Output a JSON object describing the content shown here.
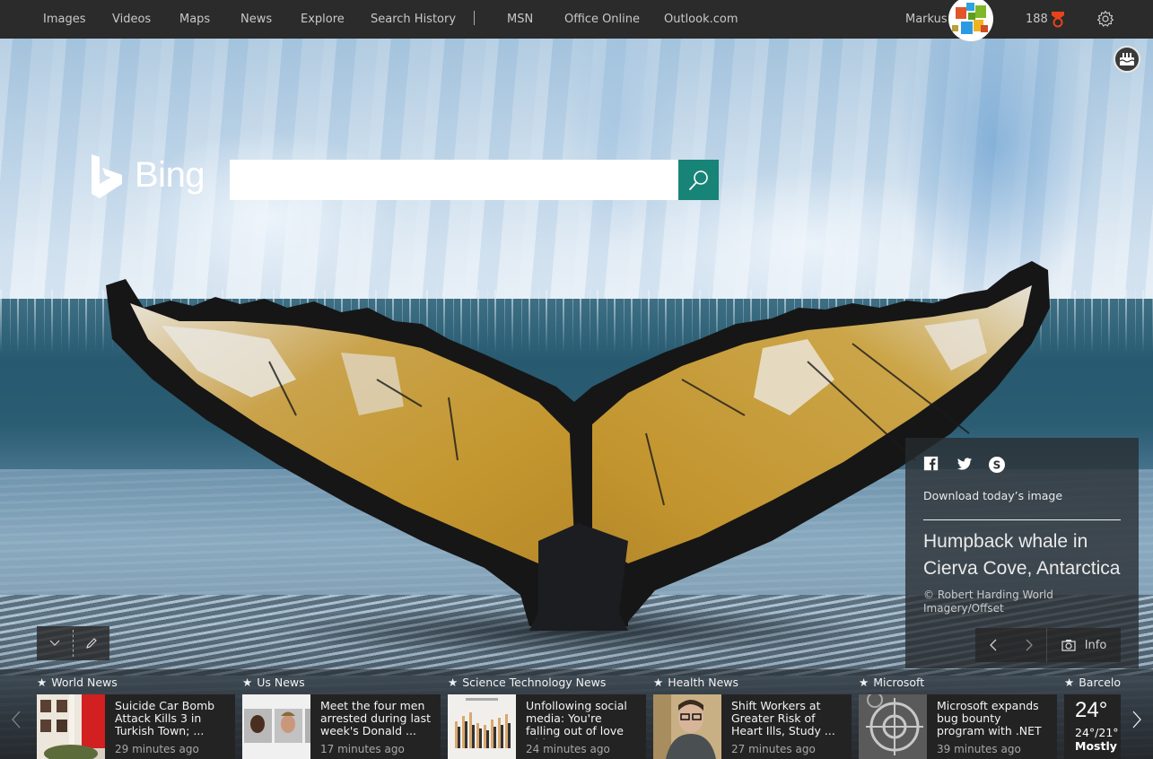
{
  "topbar": {
    "nav": [
      {
        "label": "Images"
      },
      {
        "label": "Videos"
      },
      {
        "label": "Maps"
      },
      {
        "label": "News"
      },
      {
        "label": "Explore"
      },
      {
        "label": "Search History"
      },
      {
        "label": "MSN"
      },
      {
        "label": "Office Online"
      },
      {
        "label": "Outlook.com"
      }
    ],
    "user_name": "Markus",
    "rewards_count": "188",
    "rewards_color": "#e8421c"
  },
  "search": {
    "logo_text": "Bing",
    "query": "",
    "placeholder": "",
    "button_color": "#178477"
  },
  "image_info": {
    "download_label": "Download today’s image",
    "title": "Humpback whale in Cierva Cove, Antarctica",
    "credit": "© Robert Harding World Imagery/Offset",
    "info_label": "Info",
    "social": [
      "facebook",
      "twitter",
      "skype"
    ]
  },
  "news": [
    {
      "category": "World News",
      "title": "Suicide Car Bomb Attack Kills 3 in Turkish Town; ...",
      "time": "29 minutes ago",
      "thumb": "building-photo"
    },
    {
      "category": "Us News",
      "title": "Meet the four men arrested during last week's Donald ...",
      "time": "17 minutes ago",
      "thumb": "mugshots-photo"
    },
    {
      "category": "Science Technology News",
      "title": "Unfollowing social media: You're falling out of love with ...",
      "time": "24 minutes ago",
      "thumb": "bar-chart-photo"
    },
    {
      "category": "Health News",
      "title": "Shift Workers at Greater Risk of Heart Ills, Study ...",
      "time": "27 minutes ago",
      "thumb": "tired-man-photo"
    },
    {
      "category": "Microsoft",
      "title": "Microsoft expands bug bounty program with .NET Core ...",
      "time": "39 minutes ago",
      "thumb": "target-photo"
    }
  ],
  "weather": {
    "location": "Barcelor",
    "temp": "24°",
    "range": "24°/21°",
    "condition": "Mostly S"
  }
}
